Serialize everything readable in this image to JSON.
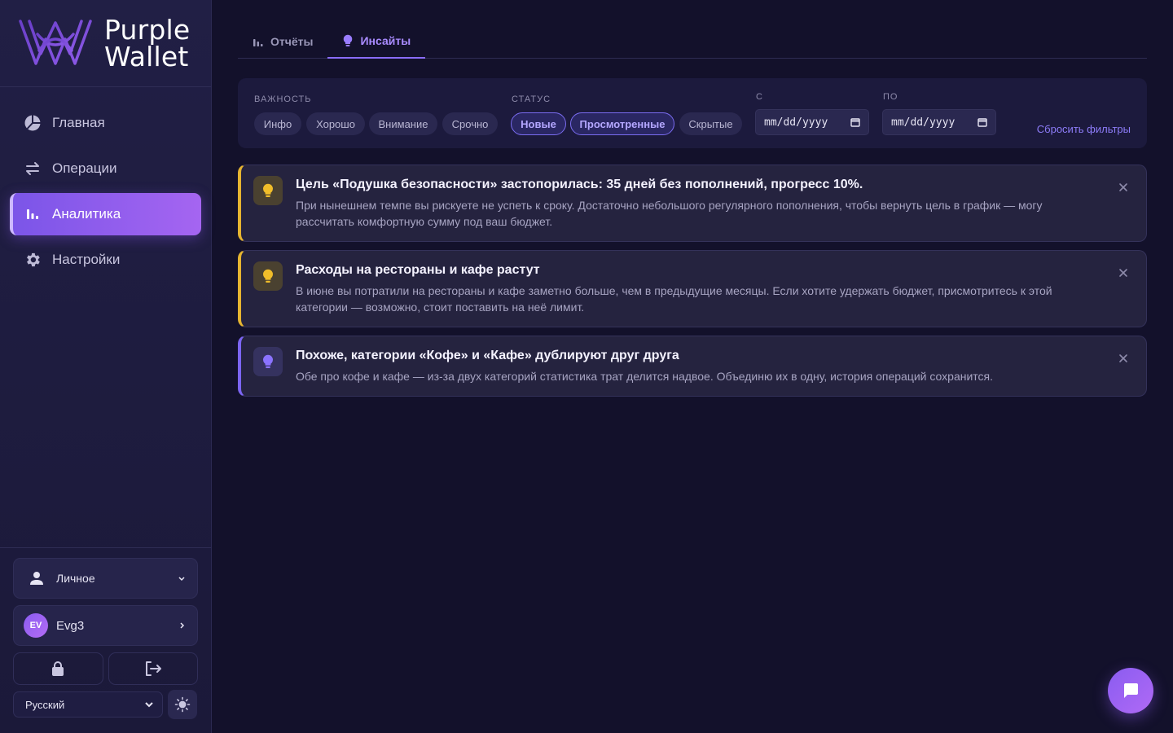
{
  "app": {
    "logo_line1": "Purple",
    "logo_line2": "Wallet"
  },
  "sidebar": {
    "items": [
      {
        "label": "Главная",
        "icon": "pie-chart-icon"
      },
      {
        "label": "Операции",
        "icon": "transfer-arrows-icon"
      },
      {
        "label": "Аналитика",
        "icon": "bar-chart-icon",
        "active": true
      },
      {
        "label": "Настройки",
        "icon": "gear-icon"
      }
    ],
    "account_type": "Личное",
    "user_initials": "EV",
    "user_name": "Evg3",
    "language": "Русский"
  },
  "tabs": [
    {
      "label": "Отчёты",
      "icon": "bar-chart-icon"
    },
    {
      "label": "Инсайты",
      "icon": "lightbulb-icon",
      "active": true
    }
  ],
  "filters": {
    "importance_label": "ВАЖНОСТЬ",
    "importance_options": [
      "Инфо",
      "Хорошо",
      "Внимание",
      "Срочно"
    ],
    "status_label": "СТАТУС",
    "status_options": [
      {
        "label": "Новые",
        "selected": true
      },
      {
        "label": "Просмотренные",
        "selected": true
      },
      {
        "label": "Скрытые",
        "selected": false
      }
    ],
    "from_label": "С",
    "from_placeholder": "mm/dd/yyyy",
    "to_label": "ПО",
    "to_placeholder": "mm/dd/yyyy",
    "reset_label": "Сбросить фильтры"
  },
  "insights": [
    {
      "severity": "warning",
      "title": "Цель «Подушка безопасности» застопорилась: 35 дней без пополнений, прогресс 10%.",
      "text": "При нынешнем темпе вы рискуете не успеть к сроку. Достаточно небольшого регулярного пополнения, чтобы вернуть цель в график — могу рассчитать комфортную сумму под ваш бюджет."
    },
    {
      "severity": "warning",
      "title": "Расходы на рестораны и кафе растут",
      "text": "В июне вы потратили на рестораны и кафе заметно больше, чем в предыдущие месяцы. Если хотите удержать бюджет, присмотритесь к этой категории — возможно, стоит поставить на неё лимит."
    },
    {
      "severity": "info",
      "title": "Похоже, категории «Кофе» и «Кафе» дублируют друг друга",
      "text": "Обе про кофе и кафе — из-за двух категорий статистика трат делится надвое. Объединю их в одну, история операций сохранится."
    }
  ],
  "colors": {
    "accent": "#8a5cf0",
    "warning": "#e6b531",
    "info": "#7c65f2",
    "background": "#13112b"
  }
}
